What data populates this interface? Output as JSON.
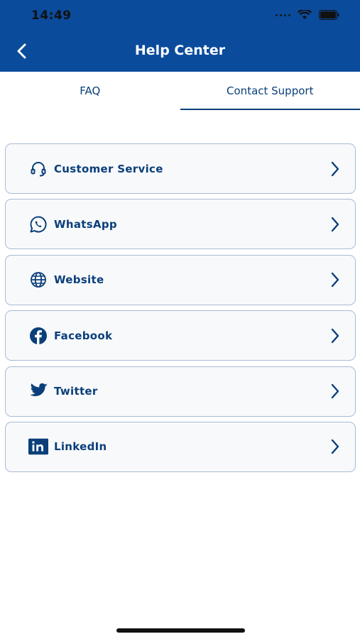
{
  "status_bar": {
    "time": "14:49"
  },
  "header": {
    "title": "Help Center",
    "back_icon": "chevron-left-icon"
  },
  "tabs": [
    {
      "label": "FAQ",
      "active": false
    },
    {
      "label": "Contact Support",
      "active": true
    }
  ],
  "contact_items": [
    {
      "label": "Customer Service",
      "icon": "headset-icon"
    },
    {
      "label": "WhatsApp",
      "icon": "whatsapp-icon"
    },
    {
      "label": "Website",
      "icon": "globe-icon"
    },
    {
      "label": "Facebook",
      "icon": "facebook-icon"
    },
    {
      "label": "Twitter",
      "icon": "twitter-icon"
    },
    {
      "label": "LinkedIn",
      "icon": "linkedin-icon"
    }
  ],
  "colors": {
    "brand": "#0a4b9c",
    "text": "#0a3f7a",
    "border": "#a8bbd6"
  }
}
